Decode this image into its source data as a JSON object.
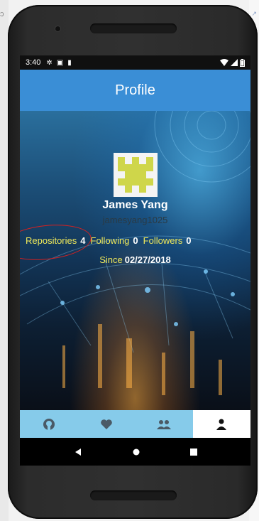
{
  "status_bar": {
    "time": "3:40"
  },
  "app_bar": {
    "title": "Profile"
  },
  "profile": {
    "name": "James Yang",
    "login": "jamesyang1025",
    "stats": {
      "repositories_label": "Repositories",
      "repositories_count": "4",
      "following_label": "Following",
      "following_count": "0",
      "followers_label": "Followers",
      "followers_count": "0"
    },
    "since_label": "Since",
    "since_date": "02/27/2018"
  },
  "bottom_nav": {
    "tabs": [
      {
        "icon": "github-icon",
        "active": false
      },
      {
        "icon": "heart-icon",
        "active": false
      },
      {
        "icon": "people-icon",
        "active": false
      },
      {
        "icon": "person-icon",
        "active": true
      }
    ]
  },
  "system_nav": {
    "buttons": [
      "back-icon",
      "home-icon",
      "overview-icon"
    ]
  },
  "colors": {
    "app_bar": "#3a8ed6",
    "nav_tab_bg": "#86cbea",
    "stat_label": "#f0e95a",
    "annotation": "#d62020"
  }
}
